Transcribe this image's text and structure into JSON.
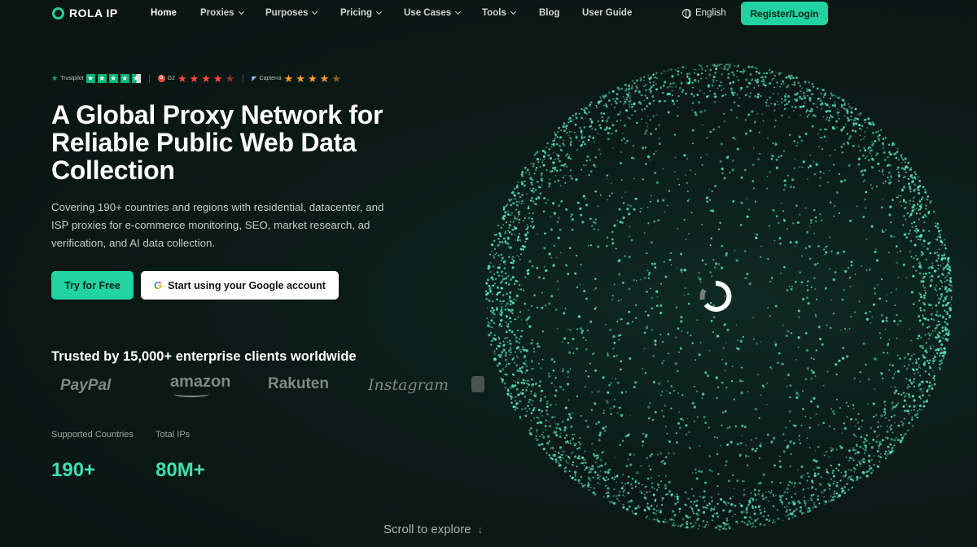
{
  "brand": {
    "name": "ROLA IP"
  },
  "nav": {
    "items": [
      {
        "label": "Home",
        "dropdown": false,
        "active": true
      },
      {
        "label": "Proxies",
        "dropdown": true
      },
      {
        "label": "Purposes",
        "dropdown": true
      },
      {
        "label": "Pricing",
        "dropdown": true
      },
      {
        "label": "Use Cases",
        "dropdown": true
      },
      {
        "label": "Tools",
        "dropdown": true
      },
      {
        "label": "Blog",
        "dropdown": false
      },
      {
        "label": "User Guide",
        "dropdown": false
      }
    ],
    "language": "English",
    "register_label": "Register/Login"
  },
  "ratings": {
    "trustpilot": {
      "name": "Trustpilot",
      "stars": 4.5
    },
    "g2": {
      "name": "G2",
      "stars": 4.5
    },
    "capterra": {
      "name": "Capterra",
      "stars": 4.5
    }
  },
  "hero": {
    "headline": "A Global Proxy Network for Reliable Public Web Data Collection",
    "subtitle": "Covering 190+ countries and regions with residential, datacenter, and ISP proxies for e-commerce monitoring, SEO, market research, ad verification, and AI data collection.",
    "try_label": "Try for Free",
    "google_label": "Start using your Google account"
  },
  "clients": {
    "title": "Trusted by 15,000+ enterprise clients worldwide",
    "logos": [
      "PayPal",
      "amazon",
      "Rakuten",
      "Instagram"
    ]
  },
  "stats": [
    {
      "label": "Supported Countries",
      "value": "190+"
    },
    {
      "label": "Total IPs",
      "value": "80M+"
    }
  ],
  "scroll_hint": "Scroll to explore",
  "colors": {
    "accent": "#21d3a0",
    "background": "#0b1a16",
    "stat_value": "#3ee0b0",
    "globe_dot": "#5ef0c4"
  }
}
